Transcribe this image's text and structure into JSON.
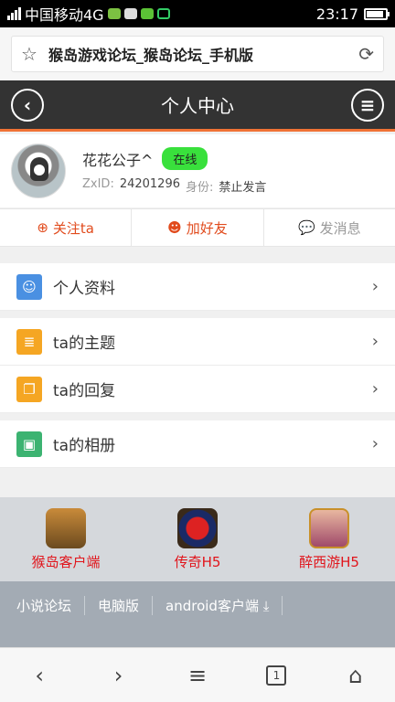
{
  "status": {
    "carrier": "中国移动4G",
    "time": "23:17"
  },
  "browser": {
    "address": "猴岛游戏论坛_猴岛论坛_手机版"
  },
  "header": {
    "title": "个人中心"
  },
  "profile": {
    "name": "花花公子^",
    "online_badge": "在线",
    "zxid_label": "ZxID:",
    "zxid_value": "24201296",
    "role_label": "身份:",
    "role_value": "禁止发言"
  },
  "actions": [
    {
      "label": "关注ta",
      "icon": "follow-icon"
    },
    {
      "label": "加好友",
      "icon": "friends-icon"
    },
    {
      "label": "发消息",
      "icon": "message-icon"
    }
  ],
  "menu": [
    {
      "label": "个人资料",
      "icon": "smiley-icon",
      "color": "#4a90e2"
    },
    {
      "label": "ta的主题",
      "icon": "document-icon",
      "color": "#f5a623"
    },
    {
      "label": "ta的回复",
      "icon": "reply-icon",
      "color": "#f5a623"
    },
    {
      "label": "ta的相册",
      "icon": "album-icon",
      "color": "#3cb371"
    }
  ],
  "apps": [
    {
      "label": "猴岛客户端",
      "icon": "monkey-app-icon"
    },
    {
      "label": "传奇H5",
      "icon": "legend-app-icon"
    },
    {
      "label": "醉西游H5",
      "icon": "xiyou-app-icon"
    }
  ],
  "footer_links": [
    "小说论坛",
    "电脑版",
    "android客户端"
  ],
  "nav": {
    "tab_count": "1"
  },
  "colors": {
    "accent": "#f07235",
    "online": "#39e03c",
    "app_label": "#e1141b"
  }
}
